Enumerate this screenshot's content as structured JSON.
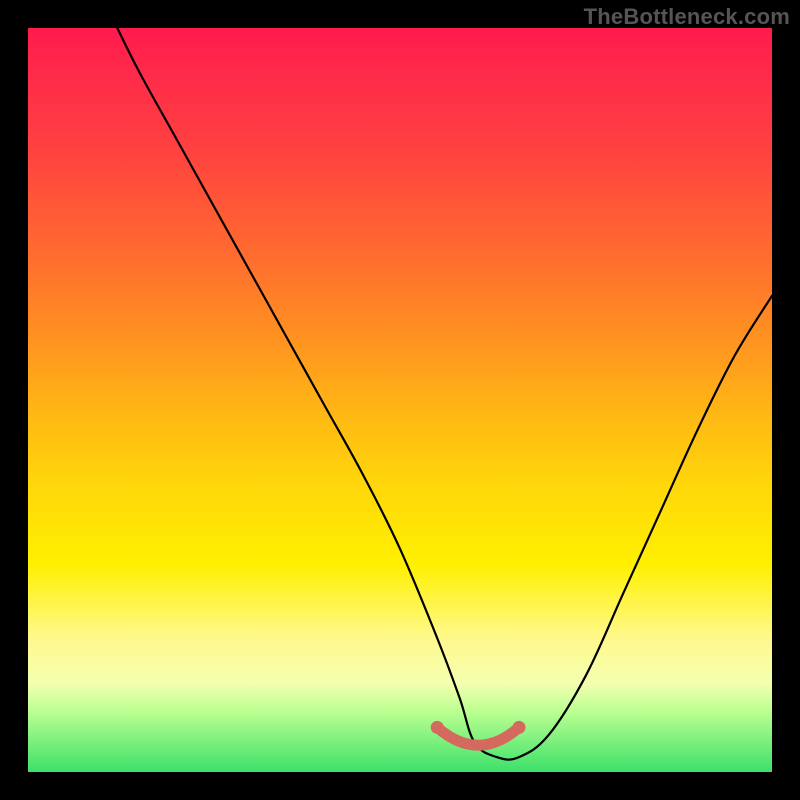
{
  "watermark": "TheBottleneck.com",
  "colors": {
    "frame_background": "#000000",
    "curve_stroke": "#000000",
    "trough_stroke": "#d46a5e",
    "gradient_stops": [
      "#ff1a4c",
      "#ff4040",
      "#ff9320",
      "#ffd80a",
      "#fff98c",
      "#3de06a"
    ]
  },
  "chart_data": {
    "type": "line",
    "title": "",
    "xlabel": "",
    "ylabel": "",
    "xlim": [
      0,
      100
    ],
    "ylim": [
      0,
      100
    ],
    "series": [
      {
        "name": "bottleneck-curve",
        "x": [
          12,
          15,
          20,
          25,
          30,
          35,
          40,
          45,
          50,
          55,
          58,
          60,
          63,
          66,
          70,
          75,
          80,
          85,
          90,
          95,
          100
        ],
        "values": [
          100,
          94,
          85,
          76,
          67,
          58,
          49,
          40,
          30,
          18,
          10,
          4,
          2,
          2,
          5,
          13,
          24,
          35,
          46,
          56,
          64
        ]
      }
    ],
    "annotations": [
      {
        "name": "trough-highlight",
        "x_range": [
          55,
          66
        ],
        "y_approx": 2,
        "color": "#d46a5e"
      }
    ]
  }
}
